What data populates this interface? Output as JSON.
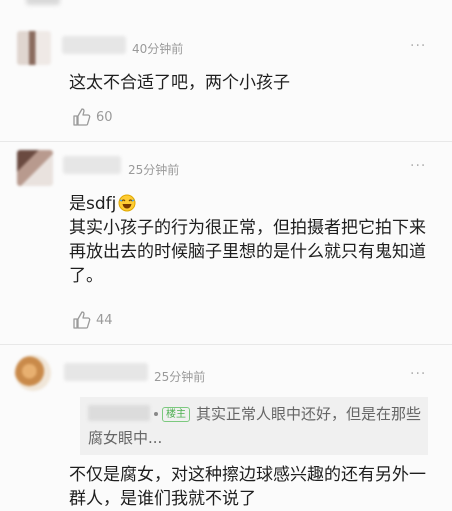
{
  "comments": [
    {
      "time": "40分钟前",
      "text": "这太不合适了吧，两个小孩子",
      "likes": "60",
      "more": "···"
    },
    {
      "time": "25分钟前",
      "text_line1": "是sdfj",
      "text_rest": "其实小孩子的行为很正常，但拍摄者把它拍下来再放出去的时候脑子里想的是什么就只有鬼知道了。",
      "likes": "44",
      "more": "···"
    },
    {
      "time": "25分钟前",
      "badge": "楼主",
      "quote_text": "其实正常人眼中还好，但是在那些腐女眼中...",
      "text": "不仅是腐女，对这种擦边球感兴趣的还有另外一群人，是谁们我就不说了",
      "more": "···"
    }
  ],
  "icons": [
    "thumbs-up-icon",
    "more-options-icon",
    "laughing-emoji-icon"
  ]
}
